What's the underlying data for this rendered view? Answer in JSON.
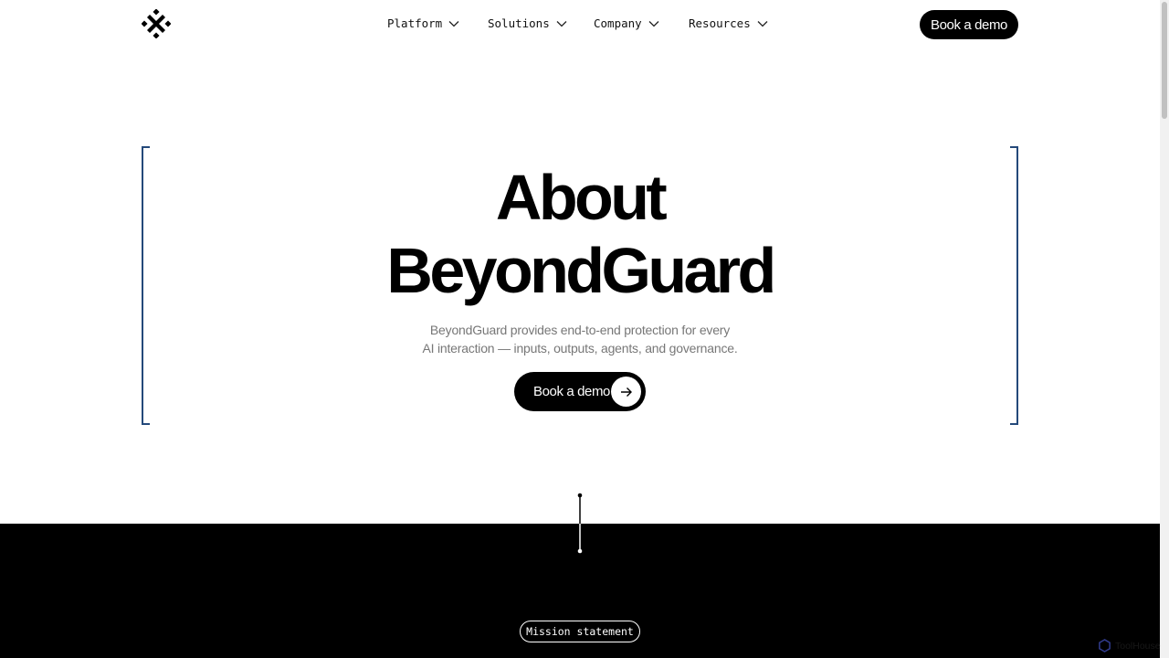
{
  "header": {
    "logo_icon": "brand-logo-icon",
    "nav": [
      {
        "label": "Platform",
        "icon": "chevron-down-icon"
      },
      {
        "label": "Solutions",
        "icon": "chevron-down-icon"
      },
      {
        "label": "Company",
        "icon": "chevron-down-icon"
      },
      {
        "label": "Resources",
        "icon": "chevron-down-icon"
      }
    ],
    "cta_label": "Book a demo"
  },
  "hero": {
    "title_line1": "About",
    "title_line2": "BeyondGuard",
    "subtitle_line1": "BeyondGuard provides end-to-end protection for every",
    "subtitle_line2": "AI interaction — inputs, outputs, agents, and governance.",
    "cta_label": "Book a demo",
    "cta_icon": "arrow-right-icon",
    "bracket_color": "#24497a"
  },
  "mission": {
    "label": "Mission statement"
  },
  "badge": {
    "icon": "hexagon-icon",
    "label": "ToolHouse"
  }
}
